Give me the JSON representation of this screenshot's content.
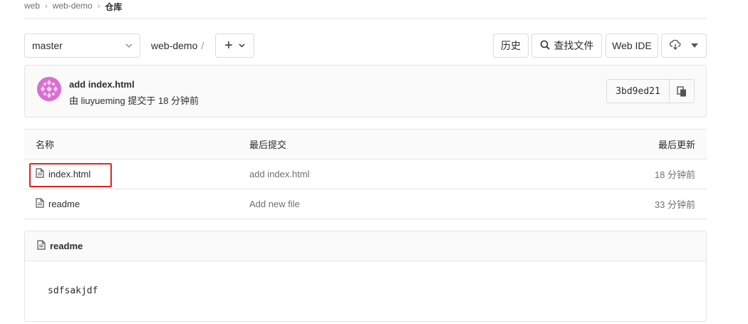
{
  "breadcrumb": {
    "items": [
      "web",
      "web-demo"
    ],
    "current": "仓库"
  },
  "toolbar": {
    "branch": "master",
    "repo_path": "web-demo",
    "path_sep": "/",
    "add_label": "+",
    "history_label": "历史",
    "find_file_label": "查找文件",
    "web_ide_label": "Web IDE"
  },
  "last_commit": {
    "title": "add index.html",
    "meta": "由 liuyueming 提交于 18 分钟前",
    "sha": "3bd9ed21"
  },
  "file_table": {
    "headers": {
      "name": "名称",
      "last_commit": "最后提交",
      "last_update": "最后更新"
    },
    "rows": [
      {
        "name": "index.html",
        "commit": "add index.html",
        "time": "18 分钟前"
      },
      {
        "name": "readme",
        "commit": "Add new file",
        "time": "33 分钟前"
      }
    ]
  },
  "readme": {
    "title": "readme",
    "content": "sdfsakjdf"
  },
  "colors": {
    "highlight": "#e3221f",
    "avatar": "#d96fd2",
    "border": "#e5e5e5",
    "panel_bg": "#fafafa"
  },
  "icons": [
    "chevron-right-icon",
    "chevron-down-icon",
    "plus-icon",
    "search-icon",
    "download-icon",
    "copy-icon",
    "file-icon"
  ]
}
